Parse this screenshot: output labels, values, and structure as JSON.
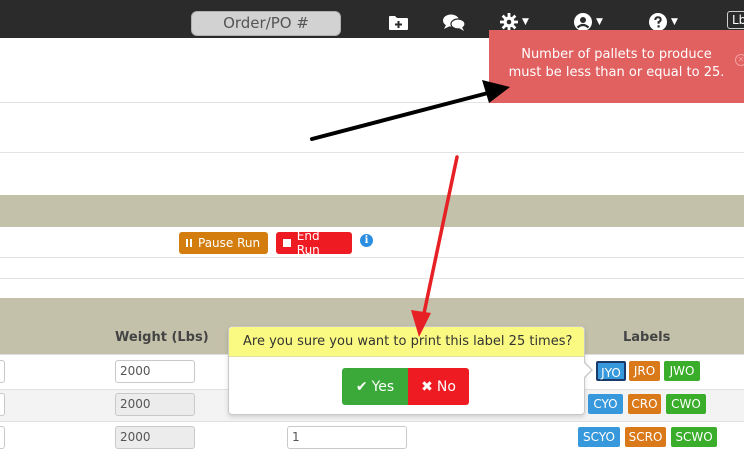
{
  "topbar": {
    "order_search_label": "Order/PO #",
    "units_label": "Lb",
    "icons": [
      "add-folder-icon",
      "chat-icon",
      "gear-icon",
      "user-icon",
      "help-icon"
    ]
  },
  "run_controls": {
    "pause_label": "Pause Run",
    "end_label": "End Run"
  },
  "table": {
    "weight_header": "Weight (Lbs)",
    "labels_header": "Labels",
    "rows": [
      {
        "weight": "2000",
        "weight_disabled": false,
        "qty": "",
        "labels": [
          "JYO",
          "JRO",
          "JWO"
        ]
      },
      {
        "weight": "2000",
        "weight_disabled": true,
        "qty": "",
        "labels": [
          "CYO",
          "CRO",
          "CWO"
        ]
      },
      {
        "weight": "2000",
        "weight_disabled": true,
        "qty": "1",
        "labels": [
          "SCYO",
          "SCRO",
          "SCWO"
        ]
      }
    ]
  },
  "toast": {
    "message_line1": "Number of pallets to produce",
    "message_line2": "must be less than or equal to 25."
  },
  "confirm": {
    "question": "Are you sure you want to print this label 25 times?",
    "yes_label": "Yes",
    "no_label": "No"
  },
  "colors": {
    "label_yellow": "#3898dc",
    "label_red": "#d9791a",
    "label_white": "#3aad2a",
    "toast_bg": "#e16060",
    "band": "#c4c1aa"
  }
}
